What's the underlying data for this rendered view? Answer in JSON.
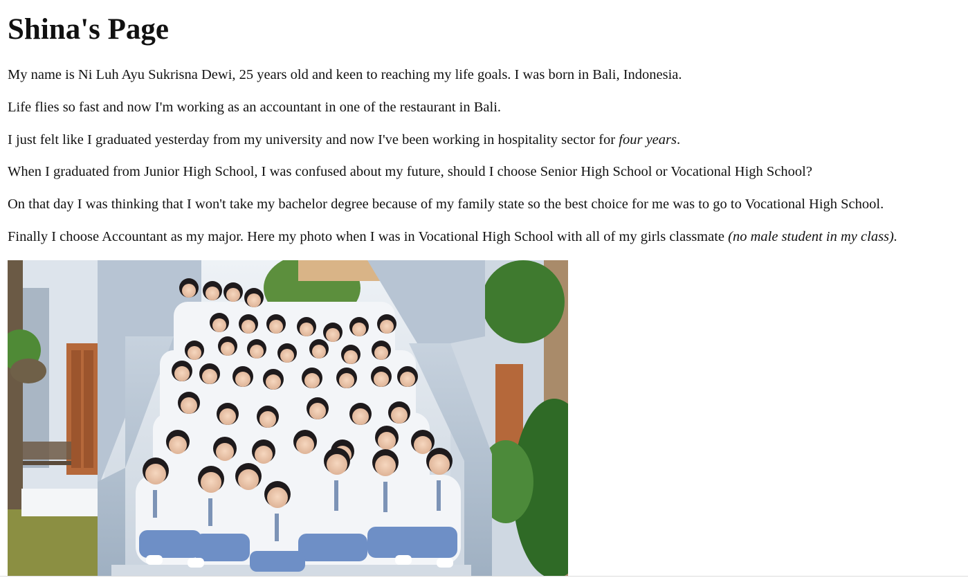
{
  "page": {
    "title": "Shina's Page"
  },
  "paragraphs": {
    "p1": "My name is Ni Luh Ayu Sukrisna Dewi, 25 years old and keen to reaching my life goals. I was born in Bali, Indonesia.",
    "p2": "Life flies so fast and now I'm working as an accountant in one of the restaurant in Bali.",
    "p3_text": "I just felt like I graduated yesterday from my university and now I've been working in hospitality sector for ",
    "p3_em": "four years",
    "p3_end": ".",
    "p4": "When I graduated from Junior High School, I was confused about my future, should I choose Senior High School or Vocational High School?",
    "p5": "On that day I was thinking that I won't take my bachelor degree because of my family state so the best choice for me was to go to Vocational High School.",
    "p6_text": "Finally I choose Accountant as my major. Here my photo when I was in Vocational High School with all of my girls classmate ",
    "p6_em": "(no male student in my class)."
  },
  "colors": {
    "text": "#111111",
    "background": "#ffffff",
    "uniform_shirt": "#f3f5f8",
    "uniform_skirt": "#6e8fc6",
    "wall": "#b9c6d6",
    "foliage": "#3f7a2f",
    "door": "#b5683a"
  },
  "icons": {
    "photo": "class-group-photo"
  }
}
